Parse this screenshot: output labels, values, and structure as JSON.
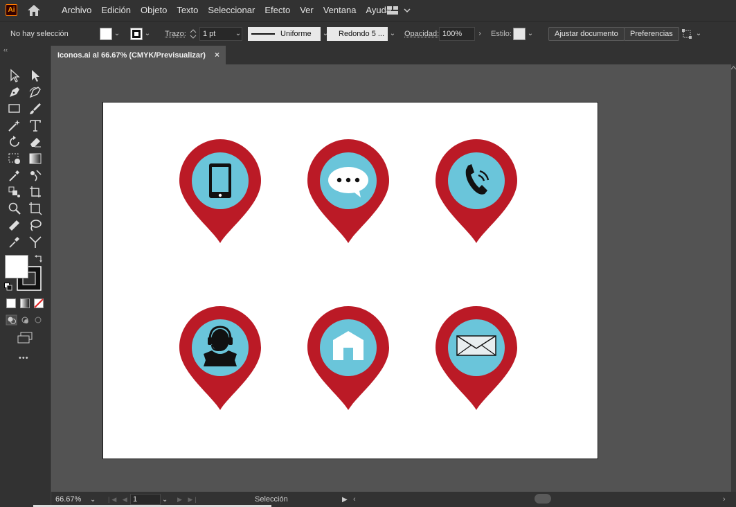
{
  "app": {
    "logo": "Ai"
  },
  "menu": [
    "Archivo",
    "Edición",
    "Objeto",
    "Texto",
    "Seleccionar",
    "Efecto",
    "Ver",
    "Ventana",
    "Ayuda"
  ],
  "control": {
    "selection": "No hay selección",
    "stroke_label": "Trazo:",
    "stroke_value": "1 pt",
    "profile": "Uniforme",
    "brush": "Redondo 5 ...",
    "opacity_label": "Opacidad:",
    "opacity_value": "100%",
    "style_label": "Estilo:",
    "fit_button": "Ajustar documento",
    "prefs_button": "Preferencias"
  },
  "document": {
    "tab_title": "Iconos.ai al 66.67% (CMYK/Previsualizar)",
    "close": "×"
  },
  "status": {
    "zoom": "66.67%",
    "artboard": "1",
    "tool": "Selección"
  },
  "toolbar": {
    "more": "•••"
  },
  "colors": {
    "pin_red": "#BB1A26",
    "circle_blue": "#6AC5DA",
    "icon_black": "#111111"
  },
  "icons": [
    "mobile-phone-icon",
    "chat-bubble-icon",
    "telephone-icon",
    "support-agent-icon",
    "home-icon",
    "envelope-icon"
  ]
}
